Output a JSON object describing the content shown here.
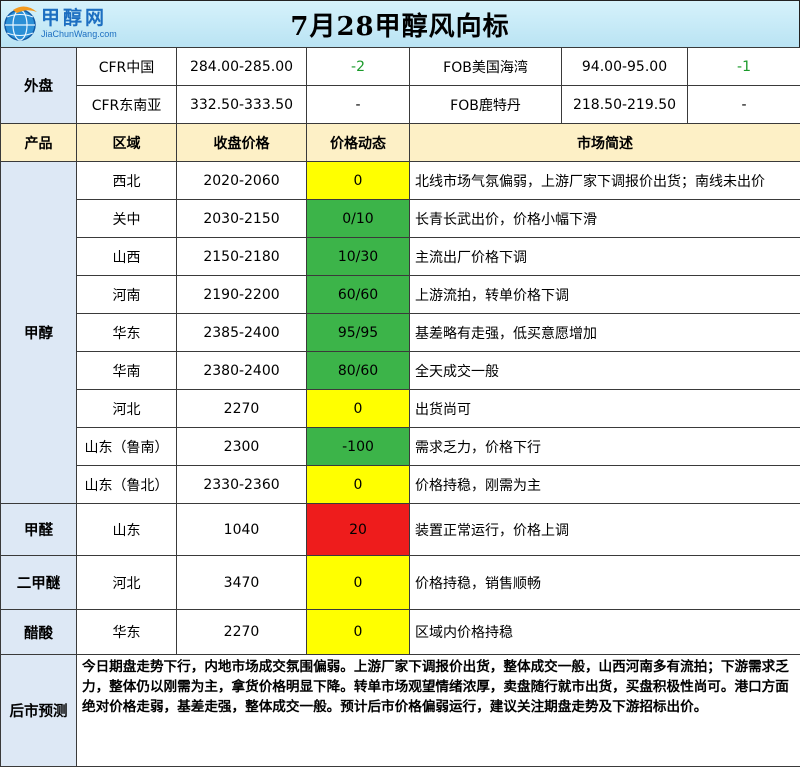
{
  "header": {
    "logo_cn": "甲醇网",
    "logo_en": "JiaChunWang.com",
    "title": "7月28甲醇风向标"
  },
  "colors": {
    "yellow": "#ffff00",
    "green": "#3cb449",
    "red": "#ee1c1c",
    "change_text_green": "#1a9a2a",
    "header_row_bg": "#fdf0c6",
    "category_bg": "#dde8f5"
  },
  "foreign": {
    "label": "外盘",
    "rows": [
      {
        "market1": "CFR中国",
        "price1": "284.00-285.00",
        "change1": "-2",
        "market2": "FOB美国海湾",
        "price2": "94.00-95.00",
        "change2": "-1"
      },
      {
        "market1": "CFR东南亚",
        "price1": "332.50-333.50",
        "change1": "-",
        "market2": "FOB鹿特丹",
        "price2": "218.50-219.50",
        "change2": "-"
      }
    ]
  },
  "columns": {
    "product": "产品",
    "region": "区域",
    "close_price": "收盘价格",
    "price_move": "价格动态",
    "brief": "市场简述"
  },
  "products": [
    {
      "name": "甲醇",
      "rows": [
        {
          "region": "西北",
          "price": "2020-2060",
          "change": "0",
          "color": "yellow",
          "brief": "北线市场气氛偏弱，上游厂家下调报价出货；南线未出价"
        },
        {
          "region": "关中",
          "price": "2030-2150",
          "change": "0/10",
          "color": "green",
          "brief": "长青长武出价，价格小幅下滑"
        },
        {
          "region": "山西",
          "price": "2150-2180",
          "change": "10/30",
          "color": "green",
          "brief": "主流出厂价格下调"
        },
        {
          "region": "河南",
          "price": "2190-2200",
          "change": "60/60",
          "color": "green",
          "brief": "上游流拍，转单价格下调"
        },
        {
          "region": "华东",
          "price": "2385-2400",
          "change": "95/95",
          "color": "green",
          "brief": "基差略有走强，低买意愿增加"
        },
        {
          "region": "华南",
          "price": "2380-2400",
          "change": "80/60",
          "color": "green",
          "brief": "全天成交一般"
        },
        {
          "region": "河北",
          "price": "2270",
          "change": "0",
          "color": "yellow",
          "brief": "出货尚可"
        },
        {
          "region": "山东（鲁南）",
          "price": "2300",
          "change": "-100",
          "color": "green",
          "brief": "需求乏力，价格下行"
        },
        {
          "region": "山东（鲁北）",
          "price": "2330-2360",
          "change": "0",
          "color": "yellow",
          "brief": "价格持稳，刚需为主"
        }
      ]
    },
    {
      "name": "甲醛",
      "rows": [
        {
          "region": "山东",
          "price": "1040",
          "change": "20",
          "color": "red",
          "brief": "装置正常运行，价格上调"
        }
      ]
    },
    {
      "name": "二甲醚",
      "rows": [
        {
          "region": "河北",
          "price": "3470",
          "change": "0",
          "color": "yellow",
          "brief": "价格持稳，销售顺畅"
        }
      ]
    },
    {
      "name": "醋酸",
      "rows": [
        {
          "region": "华东",
          "price": "2270",
          "change": "0",
          "color": "yellow",
          "brief": "区域内价格持稳"
        }
      ]
    }
  ],
  "forecast": {
    "label": "后市预测",
    "text": "今日期盘走势下行，内地市场成交氛围偏弱。上游厂家下调报价出货，整体成交一般，山西河南多有流拍；下游需求乏力，整体仍以刚需为主，拿货价格明显下降。转单市场观望情绪浓厚，卖盘随行就市出货，买盘积极性尚可。港口方面绝对价格走弱，基差走强，整体成交一般。预计后市价格偏弱运行，建议关注期盘走势及下游招标出价。"
  }
}
